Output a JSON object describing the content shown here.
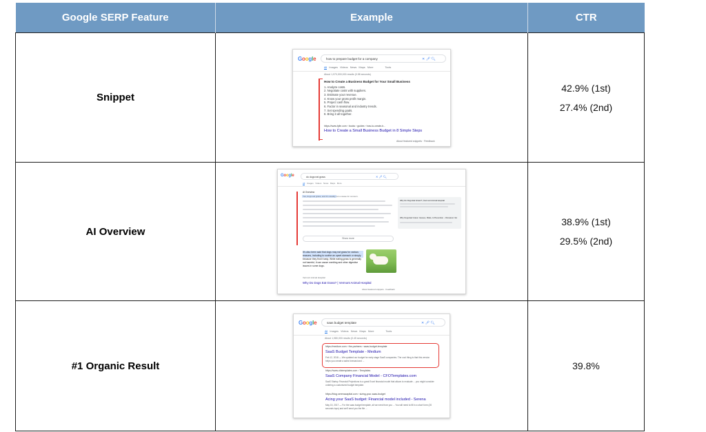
{
  "table": {
    "headers": [
      "Google SERP Feature",
      "Example",
      "CTR"
    ],
    "rows": [
      {
        "feature": "Snippet",
        "ctr": [
          "42.9% (1st)",
          "27.4% (2nd)"
        ]
      },
      {
        "feature": "AI Overview",
        "ctr": [
          "38.9% (1st)",
          "29.5% (2nd)"
        ]
      },
      {
        "feature": "#1 Organic Result",
        "ctr": [
          "39.8%"
        ]
      }
    ]
  },
  "shots": {
    "logo": "Google",
    "tabs": [
      "All",
      "Images",
      "Videos",
      "News",
      "Maps",
      "More",
      "Tools"
    ],
    "snippet": {
      "query": "how to prepare budget for a company",
      "result_count": "About 1,970,000,000 results (0.58 seconds)",
      "title": "How to Create a Business Budget for Your Small Business",
      "steps": [
        "1. Analyze costs.",
        "2. Negotiate costs with suppliers.",
        "3. Estimate your revenue.",
        "4. Know your gross profit margin.",
        "5. Project cash flow.",
        "6. Factor in seasonal and industry trends.",
        "7. Set spending goals.",
        "8. Bring it all together."
      ],
      "source_url": "https://www.fylle.com › books › guides › how-to-create-b...",
      "link": "How to Create a Small Business Budget in 8 Simple Steps",
      "footer": "About featured snippets  ·  Feedback"
    },
    "ai": {
      "query": "do dogs eat grass",
      "heading": "AI Overview",
      "lead": "Yes, dogs eat grass, and it's usually not a cause for concern.",
      "show_more": "Show more",
      "card_title": "Why Do Dogs Eat Grass? | Vermont Animal Hospital",
      "card_title2": "Why Dogs Eat Grass: Causes, Risks, & Prevention - Chewtoon Vet",
      "text": "It's also been said that dogs may eat grass for various reasons, including to soothe an upset stomach or simply because they find it tasty. While eating grass is generally not harmful, it can cause vomiting and other digestive issues in some dogs.",
      "source_name": "Vermont Animal Hospital",
      "link": "Why Do Dogs Eat Grass? | Vermont Animal Hospital",
      "footer": "About featured snippets  ·  Feedback"
    },
    "organic": {
      "query": "saas budget template",
      "result_count": "About 1,980,000 results (0.45 seconds)",
      "results": [
        {
          "url": "https://medium.com › the-partners › saas-budget-template",
          "title": "SaaS Budget Template - Medium",
          "desc": "Feb 12, 2018 — We updated our budget for early stage SaaS companies. The cool thing is that this version helps you create a sales forecast and ..."
        },
        {
          "url": "https://www.cfotemplates.com › Templates",
          "title": "SaaS Company Financial Model - CFOTemplates.com",
          "desc": "SaaS Startup Financial Projections is a great Excel financial model that allows to evaluate ... you might consider ordering a customized budget template."
        },
        {
          "url": "https://blog.serenacapital.com › sizing-your-saas-budget",
          "title": "Acing your SaaS budget: Financial model included - Serena",
          "desc": "May 15, 2017 — For the saas budget template, all we need from you ... You will need to fill in a short form (20 seconds tops) and we'll send you the file ..."
        }
      ]
    }
  }
}
